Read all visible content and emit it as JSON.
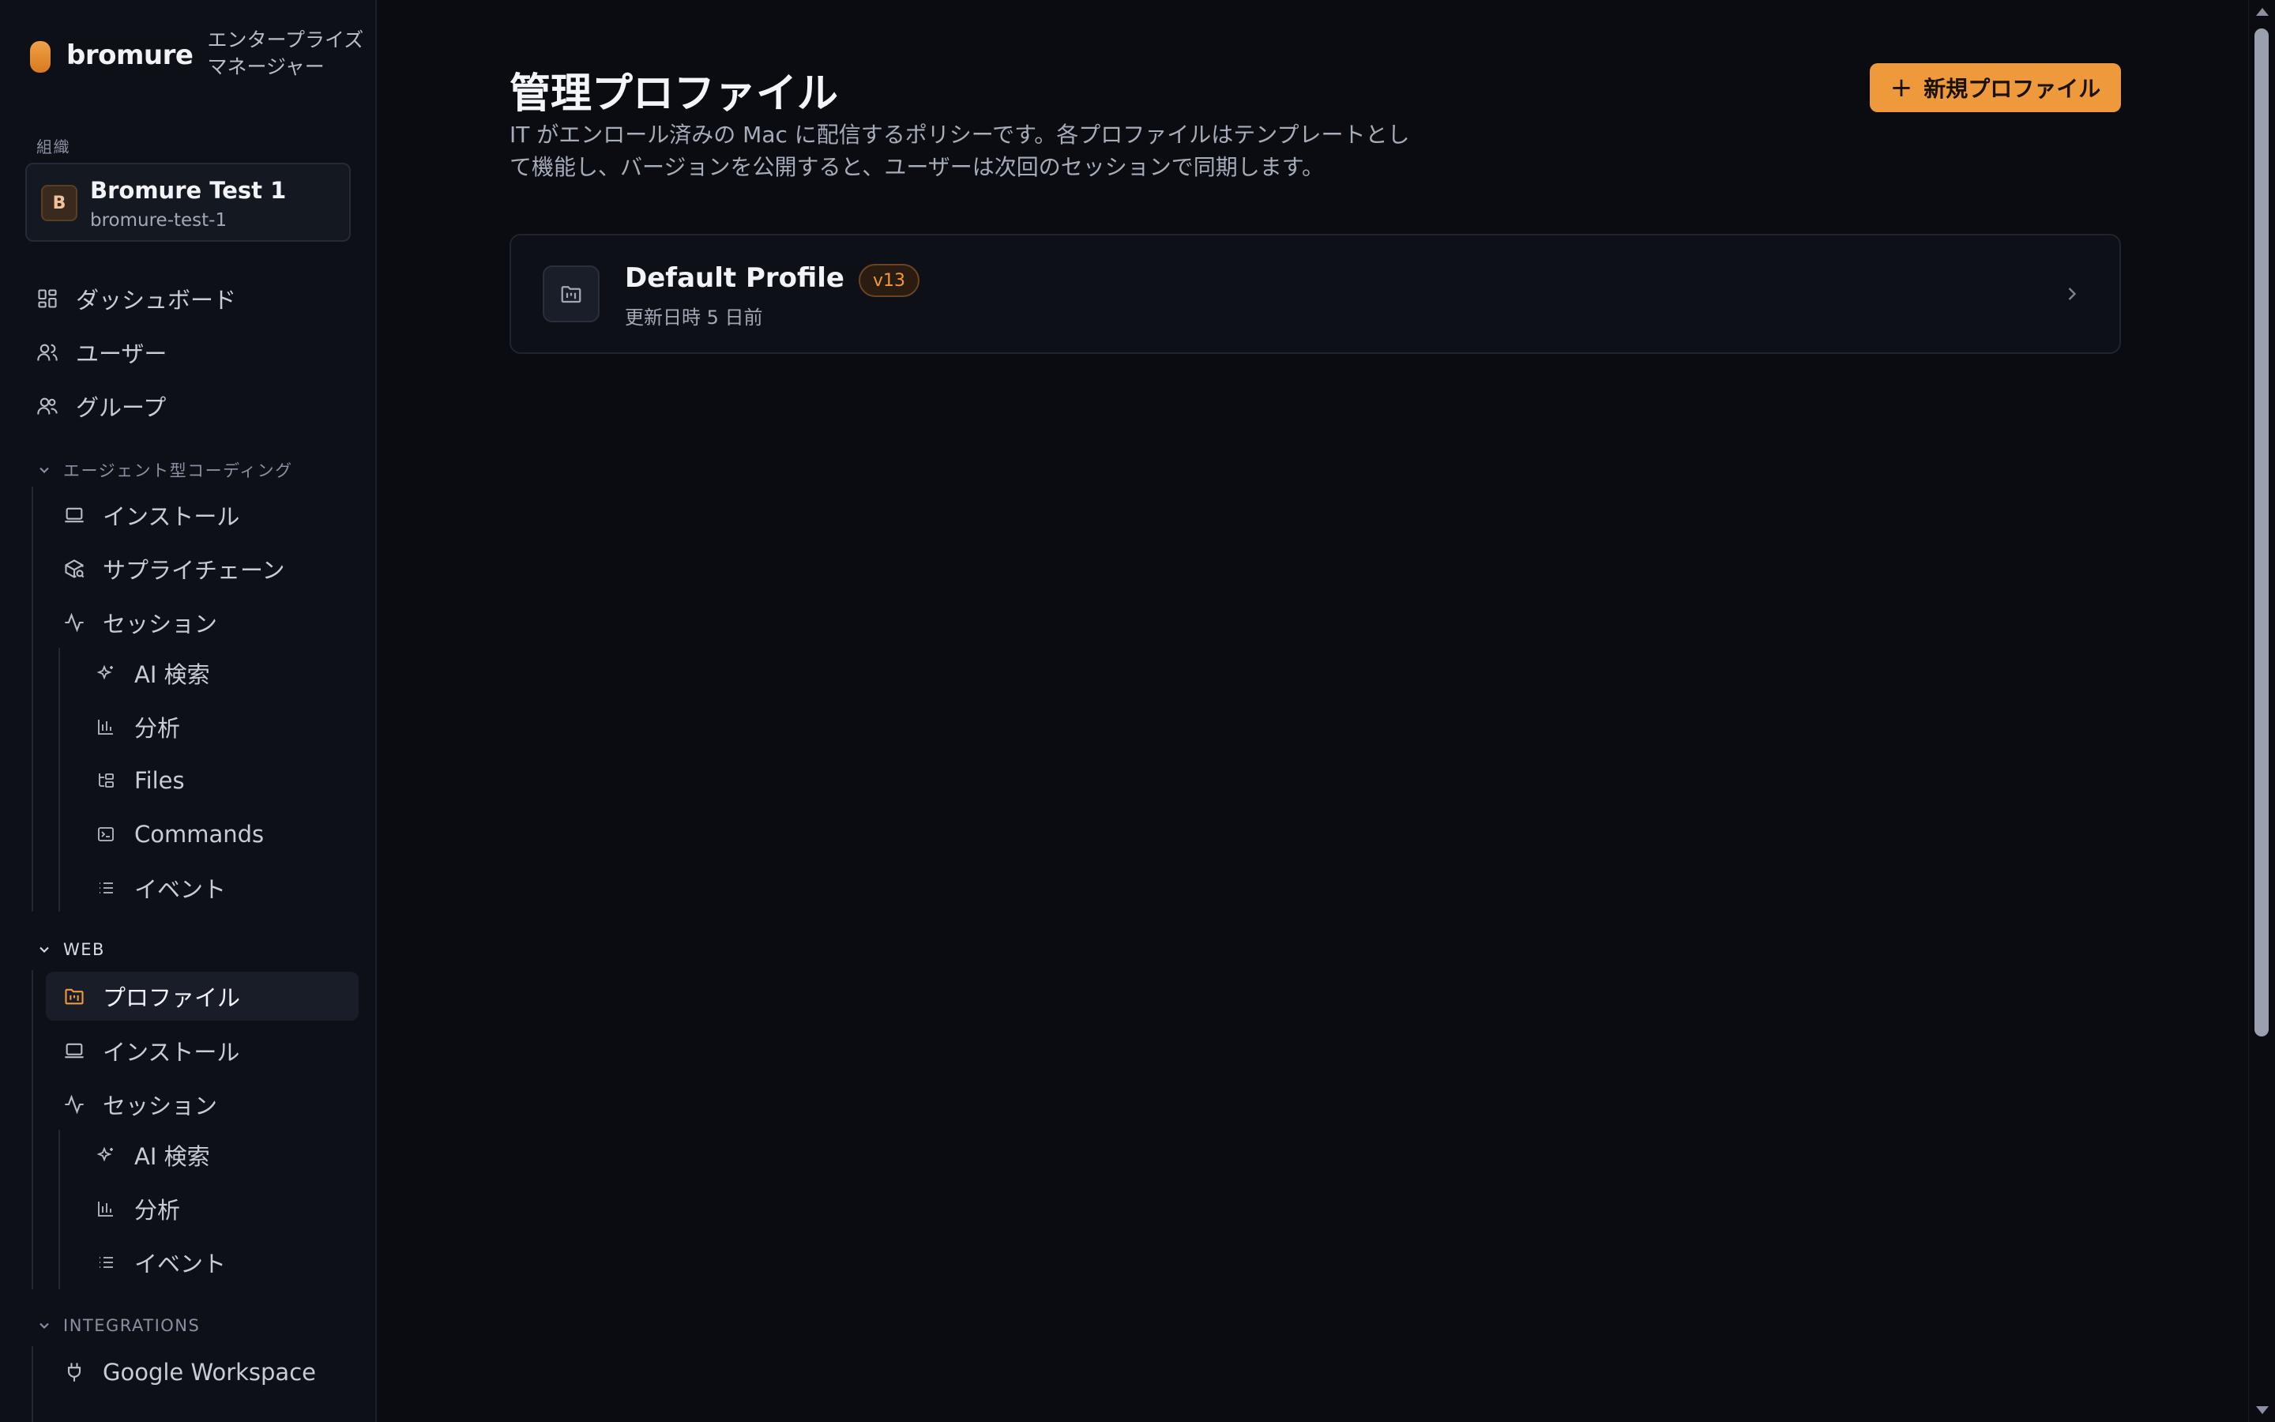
{
  "brand": {
    "name": "bromure",
    "subtitle": "エンタープライズマネージャー"
  },
  "sidebar": {
    "org_section_label": "組織",
    "org": {
      "avatar_letter": "B",
      "name": "Bromure Test 1",
      "slug": "bromure-test-1"
    },
    "top_items": [
      {
        "label": "ダッシュボード",
        "icon": "dashboard-icon"
      },
      {
        "label": "ユーザー",
        "icon": "users-icon"
      },
      {
        "label": "グループ",
        "icon": "groups-icon"
      }
    ],
    "agentic_group": {
      "label": "エージェント型コーディング",
      "items": [
        {
          "label": "インストール",
          "icon": "laptop-icon"
        },
        {
          "label": "サプライチェーン",
          "icon": "package-search-icon"
        },
        {
          "label": "セッション",
          "icon": "activity-icon"
        }
      ],
      "session_children": [
        {
          "label": "AI 検索",
          "icon": "sparkles-icon"
        },
        {
          "label": "分析",
          "icon": "bar-chart-icon"
        },
        {
          "label": "Files",
          "icon": "folder-tree-icon"
        },
        {
          "label": "Commands",
          "icon": "terminal-icon"
        },
        {
          "label": "イベント",
          "icon": "list-icon"
        }
      ]
    },
    "web_group": {
      "label": "WEB",
      "items": [
        {
          "label": "プロファイル",
          "icon": "folder-kanban-icon",
          "active": true
        },
        {
          "label": "インストール",
          "icon": "laptop-icon"
        },
        {
          "label": "セッション",
          "icon": "activity-icon"
        }
      ],
      "session_children": [
        {
          "label": "AI 検索",
          "icon": "sparkles-icon"
        },
        {
          "label": "分析",
          "icon": "bar-chart-icon"
        },
        {
          "label": "イベント",
          "icon": "list-icon"
        }
      ]
    },
    "integrations_group": {
      "label": "INTEGRATIONS",
      "items": [
        {
          "label": "Google Workspace",
          "icon": "plug-icon"
        }
      ]
    }
  },
  "main": {
    "title": "管理プロファイル",
    "description": "IT がエンロール済みの Mac に配信するポリシーです。各プロファイルはテンプレートとして機能し、バージョンを公開すると、ユーザーは次回のセッションで同期します。",
    "new_button_label": "新規プロファイル",
    "profiles": [
      {
        "name": "Default Profile",
        "version": "v13",
        "updated": "更新日時 5 日前"
      }
    ]
  },
  "colors": {
    "accent": "#ee9a3c",
    "background": "#0a0c12",
    "sidebar_bg": "#0d1017"
  }
}
